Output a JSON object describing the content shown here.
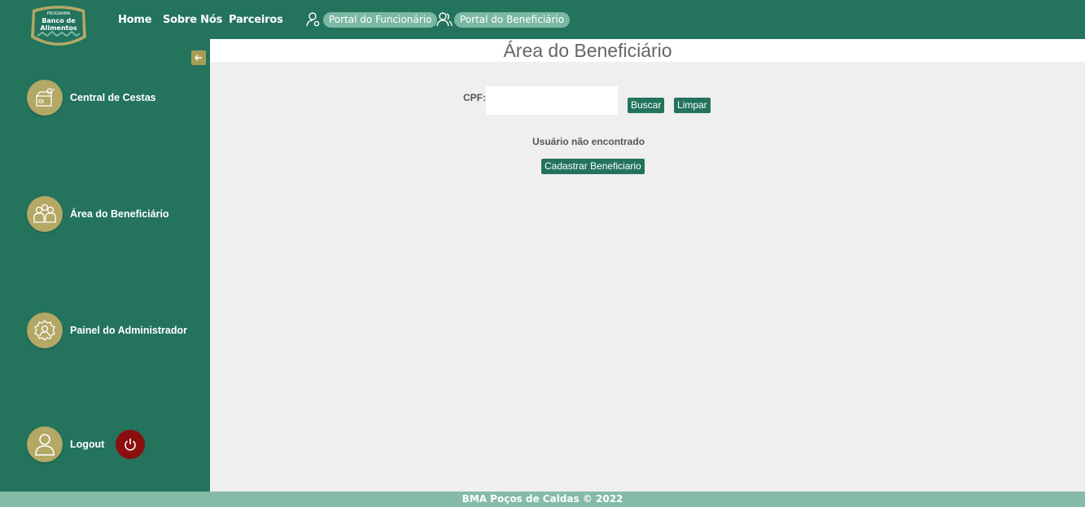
{
  "logo": {
    "top_text": "PROGRAMA",
    "name_line1": "Banco de",
    "name_line2": "Alimentos"
  },
  "nav": {
    "home": "Home",
    "sobre": "Sobre Nós",
    "parceiros": "Parceiros",
    "portal_funcionario": "Portal do Funcionário",
    "portal_beneficiario": "Portal do Beneficiário"
  },
  "sidebar": {
    "items": [
      {
        "label": "Central de Cestas",
        "icon": "basket-box-icon"
      },
      {
        "label": "Área do Beneficiário",
        "icon": "people-group-icon"
      },
      {
        "label": "Painel do Administrador",
        "icon": "admin-gear-user-icon"
      },
      {
        "label": "Logout",
        "icon": "user-icon"
      }
    ],
    "collapse_icon": "arrow-left-icon",
    "logout_power_icon": "power-icon"
  },
  "main": {
    "title": "Área do Beneficiário",
    "cpf_label": "CPF:",
    "cpf_value": "",
    "buscar_label": "Buscar",
    "limpar_label": "Limpar",
    "message": "Usuário não encontrado",
    "cadastrar_label": "Cadastrar Beneficiario"
  },
  "footer": {
    "text": "BMA Poços de Caldas © 2022"
  },
  "colors": {
    "primary": "#23735d",
    "accent_gold": "#b3a865",
    "pill": "#7ab8a3",
    "footer": "#85bba7",
    "power": "#8b0f0f"
  }
}
